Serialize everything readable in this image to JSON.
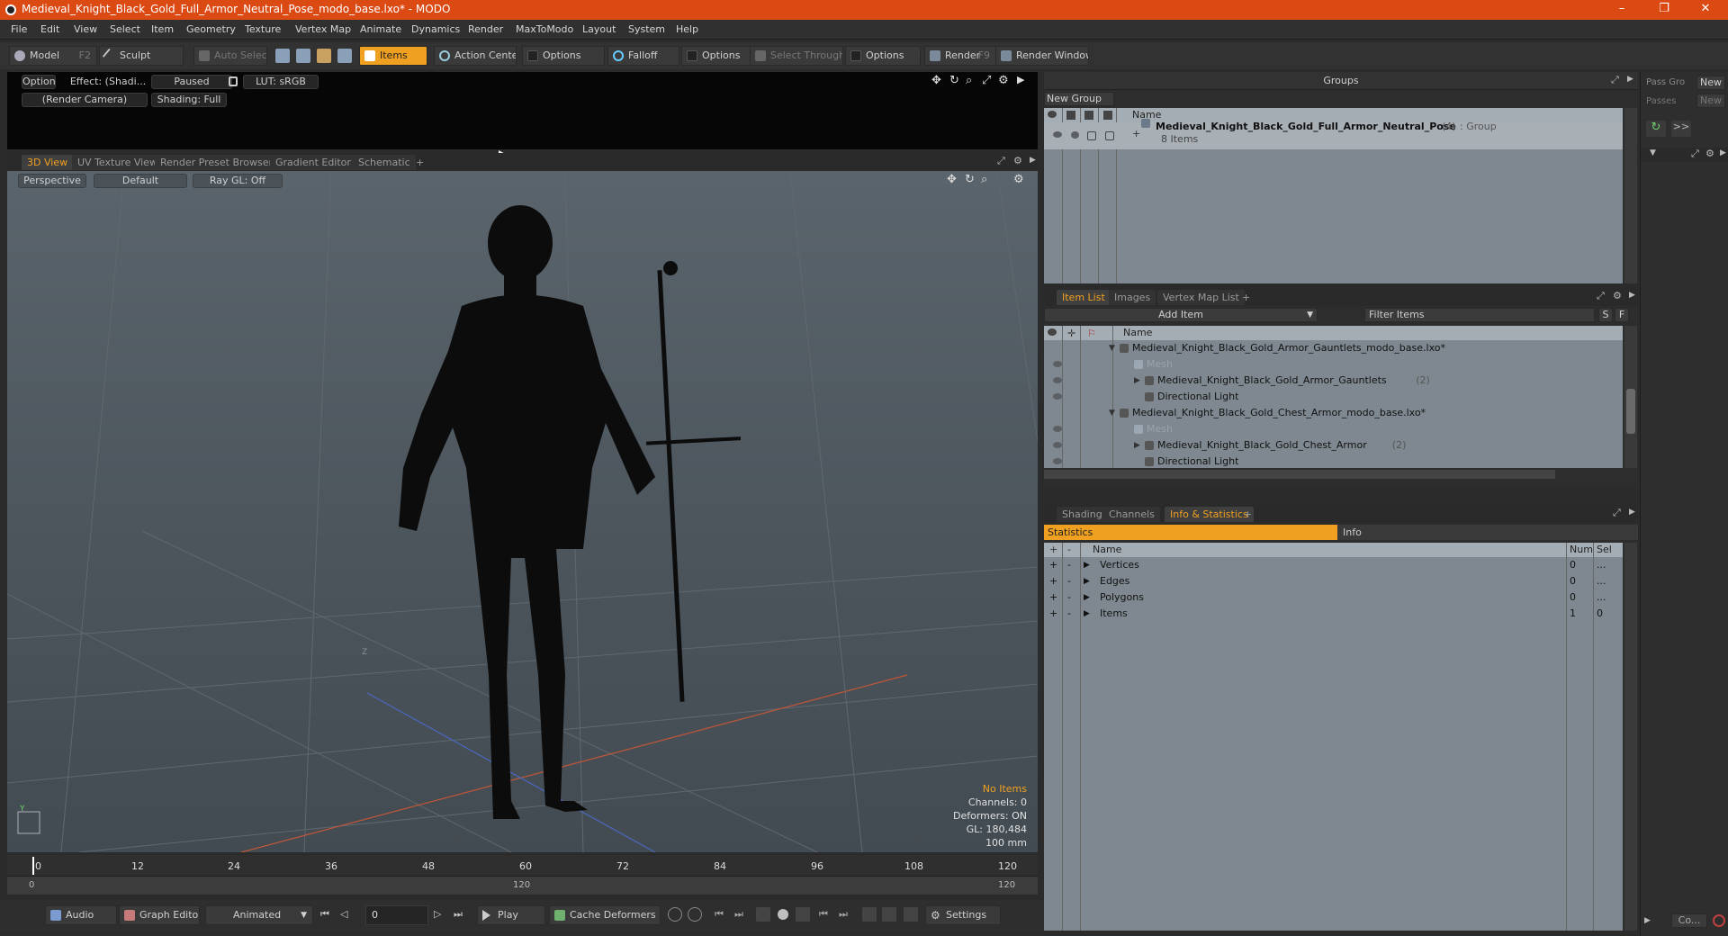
{
  "window": {
    "title": "Medieval_Knight_Black_Gold_Full_Armor_Neutral_Pose_modo_base.lxo* - MODO",
    "controls": [
      "–",
      "❐",
      "✕"
    ]
  },
  "menu": [
    "File",
    "Edit",
    "View",
    "Select",
    "Item",
    "Geometry",
    "Texture",
    "Vertex Map",
    "Animate",
    "Dynamics",
    "Render",
    "MaxToModo",
    "Layout",
    "System",
    "Help"
  ],
  "toolbar": {
    "model": "Model",
    "model_key": "F2",
    "sculpt": "Sculpt",
    "auto_select": "Auto Select",
    "items": "Items",
    "action_center": "Action Center",
    "options1": "Options",
    "falloff": "Falloff",
    "options2": "Options",
    "select_through": "Select Through",
    "options3": "Options",
    "render": "Render",
    "render_key": "F9",
    "render_window": "Render Window"
  },
  "preview": {
    "options": "Options",
    "effect": "Effect: (Shadi...",
    "paused": "Paused",
    "lut": "LUT: sRGB",
    "camera": "(Render Camera)",
    "shading": "Shading: Full"
  },
  "viewport_tabs": [
    "3D View",
    "UV Texture View",
    "Render Preset Browser",
    "Gradient Editor",
    "Schematic",
    "+"
  ],
  "viewport": {
    "perspective": "Perspective",
    "default": "Default",
    "raygl": "Ray GL: Off",
    "axis_z": "Z",
    "axis_y": "Y",
    "hud": {
      "no_items": "No Items",
      "channels": "Channels: 0",
      "deformers": "Deformers: ON",
      "gl": "GL: 180,484",
      "scale": "100 mm"
    }
  },
  "timeline": {
    "ticks": [
      "0",
      "12",
      "24",
      "36",
      "48",
      "60",
      "72",
      "84",
      "96",
      "108",
      "120"
    ],
    "range_start": "0",
    "range_mid": "120",
    "range_end": "120"
  },
  "transport": {
    "audio": "Audio",
    "graph_editor": "Graph Editor",
    "animated": "Animated",
    "frame": "0",
    "play": "Play",
    "cache_deformers": "Cache Deformers",
    "settings": "Settings"
  },
  "groups": {
    "title": "Groups",
    "new_group": "New Group",
    "col_name": "Name",
    "item_name": "Medieval_Knight_Black_Gold_Full_Armor_Neutral_Pose",
    "item_count": "(4)",
    "item_type": ": Group",
    "item_sub": "8 Items"
  },
  "pass": {
    "pass_gro": "Pass Gro",
    "passes": "Passes",
    "new1": "New",
    "new2": "New",
    "more": ">>"
  },
  "itemlist": {
    "tabs": [
      "Item List",
      "Images",
      "Vertex Map List",
      "+"
    ],
    "add_item": "Add Item",
    "filter": "Filter Items",
    "s": "S",
    "f": "F",
    "col_name": "Name",
    "rows": [
      {
        "label": "Medieval_Knight_Black_Gold_Armor_Gauntlets_modo_base.lxo*",
        "count": "",
        "dim": false
      },
      {
        "label": "Mesh",
        "count": "",
        "dim": true
      },
      {
        "label": "Medieval_Knight_Black_Gold_Armor_Gauntlets",
        "count": "(2)",
        "dim": false
      },
      {
        "label": "Directional Light",
        "count": "",
        "dim": false
      },
      {
        "label": "Medieval_Knight_Black_Gold_Chest_Armor_modo_base.lxo*",
        "count": "",
        "dim": false
      },
      {
        "label": "Mesh",
        "count": "",
        "dim": true
      },
      {
        "label": "Medieval_Knight_Black_Gold_Chest_Armor",
        "count": "(2)",
        "dim": false
      },
      {
        "label": "Directional Light",
        "count": "",
        "dim": false
      }
    ]
  },
  "stats": {
    "tabs": [
      "Shading",
      "Channels",
      "Info & Statistics",
      "+"
    ],
    "statistics": "Statistics",
    "info": "Info",
    "col_name": "Name",
    "col_num": "Num",
    "col_sel": "Sel",
    "rows": [
      {
        "name": "Vertices",
        "num": "0",
        "sel": "..."
      },
      {
        "name": "Edges",
        "num": "0",
        "sel": "..."
      },
      {
        "name": "Polygons",
        "num": "0",
        "sel": "..."
      },
      {
        "name": "Items",
        "num": "1",
        "sel": "0"
      }
    ]
  },
  "bottom_right": {
    "co": "Co..."
  },
  "colors": {
    "accent": "#f0a020",
    "titlebar": "#dc4a14"
  }
}
